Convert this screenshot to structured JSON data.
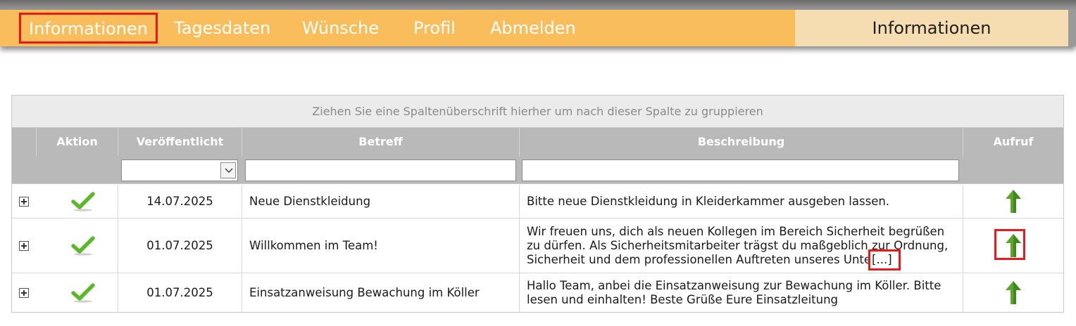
{
  "nav": {
    "items": [
      {
        "label": "Informationen"
      },
      {
        "label": "Tagesdaten"
      },
      {
        "label": "Wünsche"
      },
      {
        "label": "Profil"
      },
      {
        "label": "Abmelden"
      }
    ],
    "page_title": "Informationen"
  },
  "grid": {
    "group_hint": "Ziehen Sie eine Spaltenüberschrift hierher um nach dieser Spalte zu gruppieren",
    "columns": {
      "aktion": "Aktion",
      "veroeffentlicht": "Veröffentlicht",
      "betreff": "Betreff",
      "beschreibung": "Beschreibung",
      "aufruf": "Aufruf"
    },
    "filters": {
      "date": "",
      "betreff": "",
      "beschreibung": ""
    },
    "rows": [
      {
        "date": "14.07.2025",
        "subject": "Neue Dienstkleidung",
        "description_lines": [
          "Bitte neue Dienstkleidung in Kleiderkammer ausgeben lassen."
        ],
        "more": ""
      },
      {
        "date": "01.07.2025",
        "subject": "Willkommen im Team!",
        "description_lines": [
          "Wir freuen uns, dich als neuen Kollegen im Bereich Sicherheit begrüßen",
          "zu dürfen. Als Sicherheitsmitarbeiter trägst du maßgeblich zur Ordnung,",
          "Sicherheit und dem professionellen Auftreten unseres Unte"
        ],
        "more": "[...]"
      },
      {
        "date": "01.07.2025",
        "subject": "Einsatzanweisung Bewachung im Köller",
        "description_lines": [
          "Hallo Team, anbei die Einsatzanweisung zur Bewachung im Köller. Bitte",
          "lesen und einhalten! Beste Grüße Eure Einsatzleitung"
        ],
        "more": ""
      }
    ]
  },
  "colors": {
    "nav_bg": "#f9be5b",
    "title_bg": "#f6ddb1",
    "header_bg": "#b9b9b9",
    "check_green": "#5cb82a",
    "arrow_green": "#5ea62b",
    "highlight_red": "#e8191b"
  },
  "icons": {
    "action": "checkmark-icon",
    "open": "arrow-up-icon",
    "expand": "expand-plus-icon",
    "dropdown": "chevron-down-icon"
  }
}
